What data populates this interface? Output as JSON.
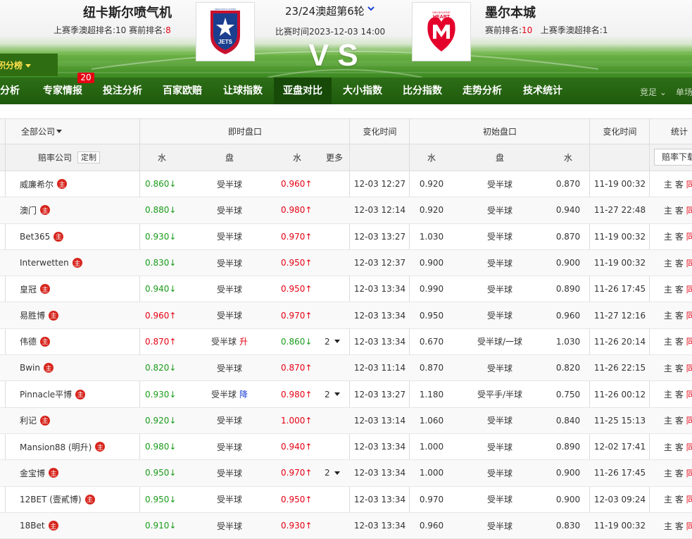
{
  "header": {
    "home_team": "纽卡斯尔喷气机",
    "away_team": "墨尔本城",
    "home_rank_prefix": "上赛季澳超排名:10   赛前排名:",
    "home_rank_value": "8",
    "away_rank_prefix": "赛前排名:",
    "away_rank_value": "10",
    "away_rank_suffix": "上赛季澳超排名:1",
    "round": "23/24澳超第6轮",
    "match_time": "比赛时间2023-12-03 14:00",
    "vs": "VS",
    "home_logo_text": "JETS",
    "home_logo_top": "NEWCASTLE UNITED",
    "away_logo_text": "HEART",
    "away_logo_top": "MELBOURNE",
    "standings_label": "积分榜"
  },
  "nav": {
    "items": [
      "数据分析",
      "专家情报",
      "投注分析",
      "百家欧赔",
      "让球指数",
      "亚盘对比",
      "大小指数",
      "比分指数",
      "走势分析",
      "技术统计"
    ],
    "active_index": 5,
    "badge": "20",
    "right_select": "竞足",
    "right_more": "单场"
  },
  "table": {
    "header1": {
      "company": "全部公司",
      "live": "即时盘口",
      "change_time": "变化时间",
      "initial": "初始盘口",
      "change_time2": "变化时间",
      "stats": "统计"
    },
    "header2": {
      "company_label": "赔率公司",
      "custom": "定制",
      "water1": "水",
      "handicap": "盘",
      "water2": "水",
      "more": "更多",
      "iwater1": "水",
      "ihandicap": "盘",
      "iwater2": "水",
      "download": "赔率下载"
    },
    "rows": [
      {
        "company": "威廉希尔",
        "w1": "0.860↓",
        "w1c": "green",
        "pan": "受半球",
        "tag": "",
        "w2": "0.960↑",
        "w2c": "red",
        "more": "",
        "t1": "12-03 12:27",
        "iw1": "0.920",
        "ipan": "受半球",
        "iw2": "0.870",
        "t2": "11-19 00:32",
        "stat": "主 客 同"
      },
      {
        "company": "澳门",
        "w1": "0.880↓",
        "w1c": "green",
        "pan": "受半球",
        "tag": "",
        "w2": "0.980↑",
        "w2c": "red",
        "more": "",
        "t1": "12-03 12:14",
        "iw1": "0.920",
        "ipan": "受半球",
        "iw2": "0.940",
        "t2": "11-27 22:48",
        "stat": "主 客 同"
      },
      {
        "company": "Bet365",
        "w1": "0.930↓",
        "w1c": "green",
        "pan": "受半球",
        "tag": "",
        "w2": "0.970↑",
        "w2c": "red",
        "more": "",
        "t1": "12-03 13:27",
        "iw1": "1.030",
        "ipan": "受半球",
        "iw2": "0.870",
        "t2": "11-19 00:32",
        "stat": "主 客 同"
      },
      {
        "company": "Interwetten",
        "w1": "0.830↓",
        "w1c": "green",
        "pan": "受半球",
        "tag": "",
        "w2": "0.950↑",
        "w2c": "red",
        "more": "",
        "t1": "12-03 12:37",
        "iw1": "0.900",
        "ipan": "受半球",
        "iw2": "0.900",
        "t2": "11-19 00:32",
        "stat": "主 客 同"
      },
      {
        "company": "皇冠",
        "w1": "0.940↓",
        "w1c": "green",
        "pan": "受半球",
        "tag": "",
        "w2": "0.950↑",
        "w2c": "red",
        "more": "",
        "t1": "12-03 13:34",
        "iw1": "0.990",
        "ipan": "受半球",
        "iw2": "0.890",
        "t2": "11-26 17:45",
        "stat": "主 客 同"
      },
      {
        "company": "易胜博",
        "w1": "0.960↑",
        "w1c": "red",
        "pan": "受半球",
        "tag": "",
        "w2": "0.970↑",
        "w2c": "red",
        "more": "",
        "t1": "12-03 13:34",
        "iw1": "0.950",
        "ipan": "受半球",
        "iw2": "0.960",
        "t2": "11-27 12:16",
        "stat": "主 客 同"
      },
      {
        "company": "伟德",
        "w1": "0.870↑",
        "w1c": "red",
        "pan": "受半球",
        "tag": "升",
        "tagc": "red",
        "w2": "0.860↓",
        "w2c": "green",
        "more": "2",
        "t1": "12-03 13:34",
        "iw1": "0.670",
        "ipan": "受半球/一球",
        "iw2": "1.030",
        "t2": "11-26 20:14",
        "stat": "主 客 同"
      },
      {
        "company": "Bwin",
        "w1": "0.820↓",
        "w1c": "green",
        "pan": "受半球",
        "tag": "",
        "w2": "0.870↑",
        "w2c": "red",
        "more": "",
        "t1": "12-03 11:14",
        "iw1": "0.870",
        "ipan": "受半球",
        "iw2": "0.820",
        "t2": "11-26 22:15",
        "stat": "主 客 同"
      },
      {
        "company": "Pinnacle平博",
        "w1": "0.930↓",
        "w1c": "green",
        "pan": "受半球",
        "tag": "降",
        "tagc": "blue",
        "w2": "0.980↑",
        "w2c": "red",
        "more": "2",
        "t1": "12-03 13:27",
        "iw1": "1.180",
        "ipan": "受平手/半球",
        "iw2": "0.750",
        "t2": "11-26 00:12",
        "stat": "主 客 同"
      },
      {
        "company": "利记",
        "w1": "0.920↓",
        "w1c": "green",
        "pan": "受半球",
        "tag": "",
        "w2": "1.000↑",
        "w2c": "red",
        "more": "",
        "t1": "12-03 13:14",
        "iw1": "1.060",
        "ipan": "受半球",
        "iw2": "0.840",
        "t2": "11-25 15:13",
        "stat": "主 客 同"
      },
      {
        "company": "Mansion88 (明升)",
        "w1": "0.980↓",
        "w1c": "green",
        "pan": "受半球",
        "tag": "",
        "w2": "0.940↑",
        "w2c": "red",
        "more": "",
        "t1": "12-03 13:34",
        "iw1": "1.000",
        "ipan": "受半球",
        "iw2": "0.890",
        "t2": "12-02 17:41",
        "stat": "主 客 同"
      },
      {
        "company": "金宝博",
        "w1": "0.950↓",
        "w1c": "green",
        "pan": "受半球",
        "tag": "",
        "w2": "0.970↑",
        "w2c": "red",
        "more": "2",
        "t1": "12-03 13:34",
        "iw1": "1.000",
        "ipan": "受半球",
        "iw2": "0.900",
        "t2": "11-26 17:45",
        "stat": "主 客 同"
      },
      {
        "company": "12BET (壹貳博)",
        "w1": "0.950↓",
        "w1c": "green",
        "pan": "受半球",
        "tag": "",
        "w2": "0.950↑",
        "w2c": "red",
        "more": "",
        "t1": "12-03 13:34",
        "iw1": "0.970",
        "ipan": "受半球",
        "iw2": "0.900",
        "t2": "12-03 09:24",
        "stat": "主 客 同"
      },
      {
        "company": "18Bet",
        "w1": "0.910↓",
        "w1c": "green",
        "pan": "受半球",
        "tag": "",
        "w2": "0.930↑",
        "w2c": "red",
        "more": "",
        "t1": "12-03 13:34",
        "iw1": "0.960",
        "ipan": "受半球",
        "iw2": "0.830",
        "t2": "11-19 00:32",
        "stat": "主 客 同"
      }
    ],
    "company_icon": "主"
  }
}
